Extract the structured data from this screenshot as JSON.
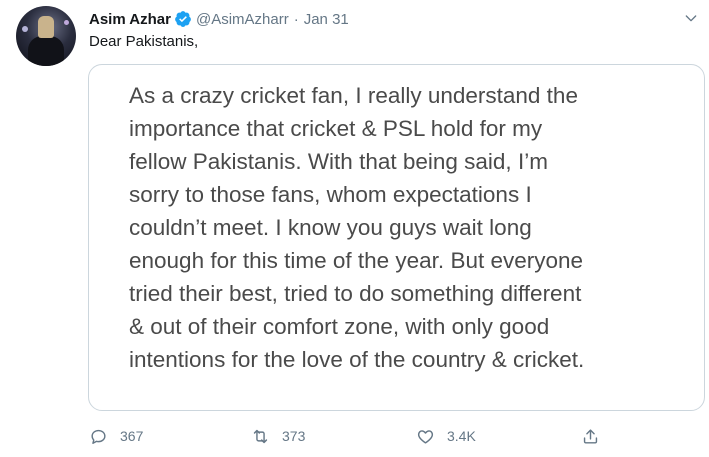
{
  "tweet": {
    "author_name": "Asim Azhar",
    "handle": "@AsimAzharr",
    "separator": "·",
    "date": "Jan 31",
    "text": "Dear Pakistanis,"
  },
  "media": {
    "lines": [
      "As a crazy cricket fan, I really understand the",
      "importance that cricket & PSL hold for my",
      "fellow Pakistanis. With that being said, I’m",
      "sorry to those fans, whom expectations I",
      "couldn’t meet. I know you guys wait long",
      "enough for this time of the year. But everyone",
      "tried their best, tried to do something different",
      "& out of their comfort zone, with only good",
      "intentions for the love of the country & cricket."
    ]
  },
  "actions": {
    "replies": "367",
    "retweets": "373",
    "likes": "3.4K"
  },
  "colors": {
    "verified": "#1da1f2",
    "secondary_text": "#657786",
    "border": "#ccd6dd"
  },
  "icons": [
    "verified-badge-icon",
    "chevron-down-icon",
    "reply-icon",
    "retweet-icon",
    "like-icon",
    "share-icon"
  ]
}
